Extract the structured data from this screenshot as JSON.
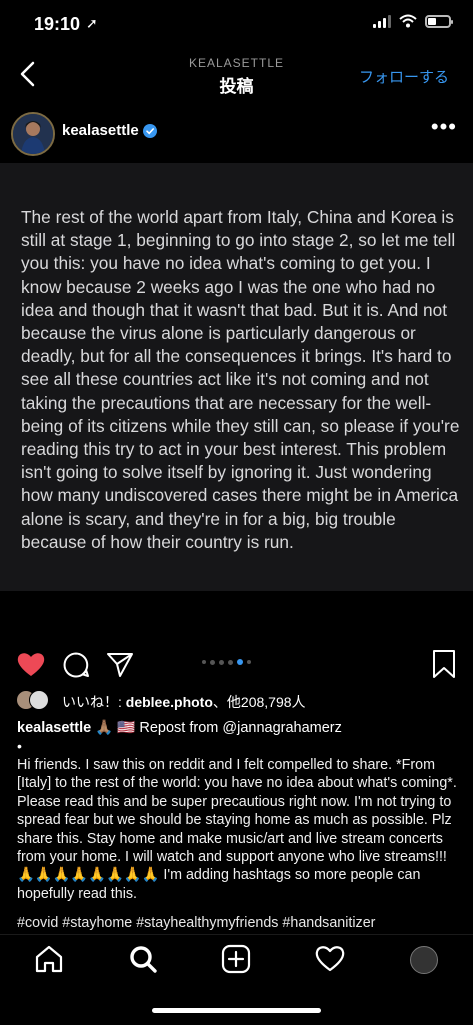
{
  "status": {
    "time": "19:10",
    "location_arrow": "➚"
  },
  "nav": {
    "subtitle": "KEALASETTLE",
    "title": "投稿",
    "follow_label": "フォローする"
  },
  "post": {
    "username": "kealasettle",
    "image_text": "The rest of the world apart from Italy, China and Korea is still at stage 1, beginning to go into stage 2, so let me tell you this: you have no idea what's coming to get you. I know because 2 weeks ago I was the one who had no idea and though that it wasn't that bad. But it is. And not because the virus alone is particularly dangerous or deadly, but for all the consequences it brings. It's hard to see all these countries act like it's not coming and not taking the precautions that are necessary for the well-being of its citizens while they still can, so please if you're reading this try to act in your best interest. This problem isn't going to solve itself by ignoring it. Just wondering how many undiscovered cases there might be in America alone is scary, and they're in for a big, big trouble because of how their country is run.",
    "carousel_active_index": 5,
    "carousel_dot_count": 6
  },
  "likes": {
    "prefix": "いいね！: ",
    "user": "deblee.photo",
    "suffix": "、他208,798人"
  },
  "caption": {
    "username": "kealasettle",
    "emoji": " 🙏🏽 🇺🇸 ",
    "repost": "Repost from @jannagrahamerz",
    "bullet": "•",
    "body": "Hi friends. I saw this on reddit and I felt compelled to share. *From [Italy] to the rest of the world: you have no idea about what's coming*. Please read this and be super precautious right now. I'm not trying to spread fear but we should be staying home as much as possible. Plz share this. Stay home and make music/art and live stream concerts from your home. I will watch and support anyone who live streams!!! 🙏🙏🙏🙏🙏🙏🙏🙏 I'm adding hashtags so more people can hopefully read this.",
    "hashtags": "#covid #stayhome #stayhealthymyfriends #handsanitizer"
  },
  "icons": {
    "back": "chevron-left-icon",
    "verified": "verified-badge-icon",
    "more": "more-horizontal-icon",
    "like": "heart-icon",
    "comment": "comment-icon",
    "share": "paper-plane-icon",
    "save": "bookmark-icon",
    "home": "home-icon",
    "search": "search-icon",
    "add": "plus-square-icon",
    "activity": "heart-outline-icon"
  },
  "colors": {
    "accent": "#3897f0",
    "like": "#ed4956",
    "background": "#000000"
  }
}
